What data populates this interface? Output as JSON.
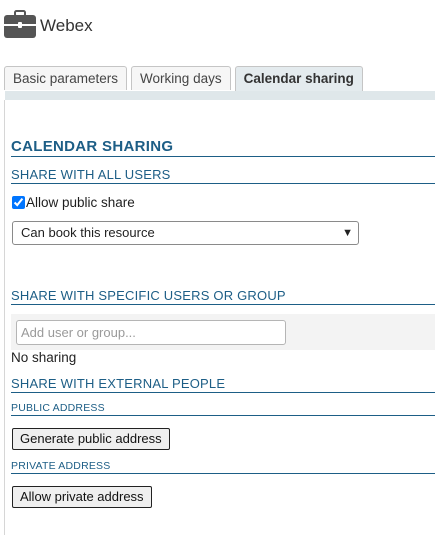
{
  "app": {
    "title": "Webex",
    "icon": "briefcase-icon"
  },
  "tabs": [
    {
      "label": "Basic parameters"
    },
    {
      "label": "Working days"
    },
    {
      "label": "Calendar sharing"
    }
  ],
  "active_tab": "Calendar sharing",
  "section": {
    "title": "CALENDAR SHARING",
    "all_users": {
      "heading": "SHARE WITH ALL USERS",
      "checkbox_label": "Allow public share",
      "checked": true,
      "select_value": "Can book this resource"
    },
    "specific": {
      "heading": "SHARE WITH SPECIFIC USERS OR GROUP",
      "input_placeholder": "Add user or group...",
      "empty_text": "No sharing"
    },
    "external": {
      "heading": "SHARE WITH EXTERNAL PEOPLE",
      "public_heading": "PUBLIC ADDRESS",
      "public_button": "Generate public address",
      "private_heading": "PRIVATE ADDRESS",
      "private_button": "Allow private address"
    }
  },
  "colors": {
    "heading": "#1d5e86",
    "active_tab_bg": "#e4ebee"
  }
}
